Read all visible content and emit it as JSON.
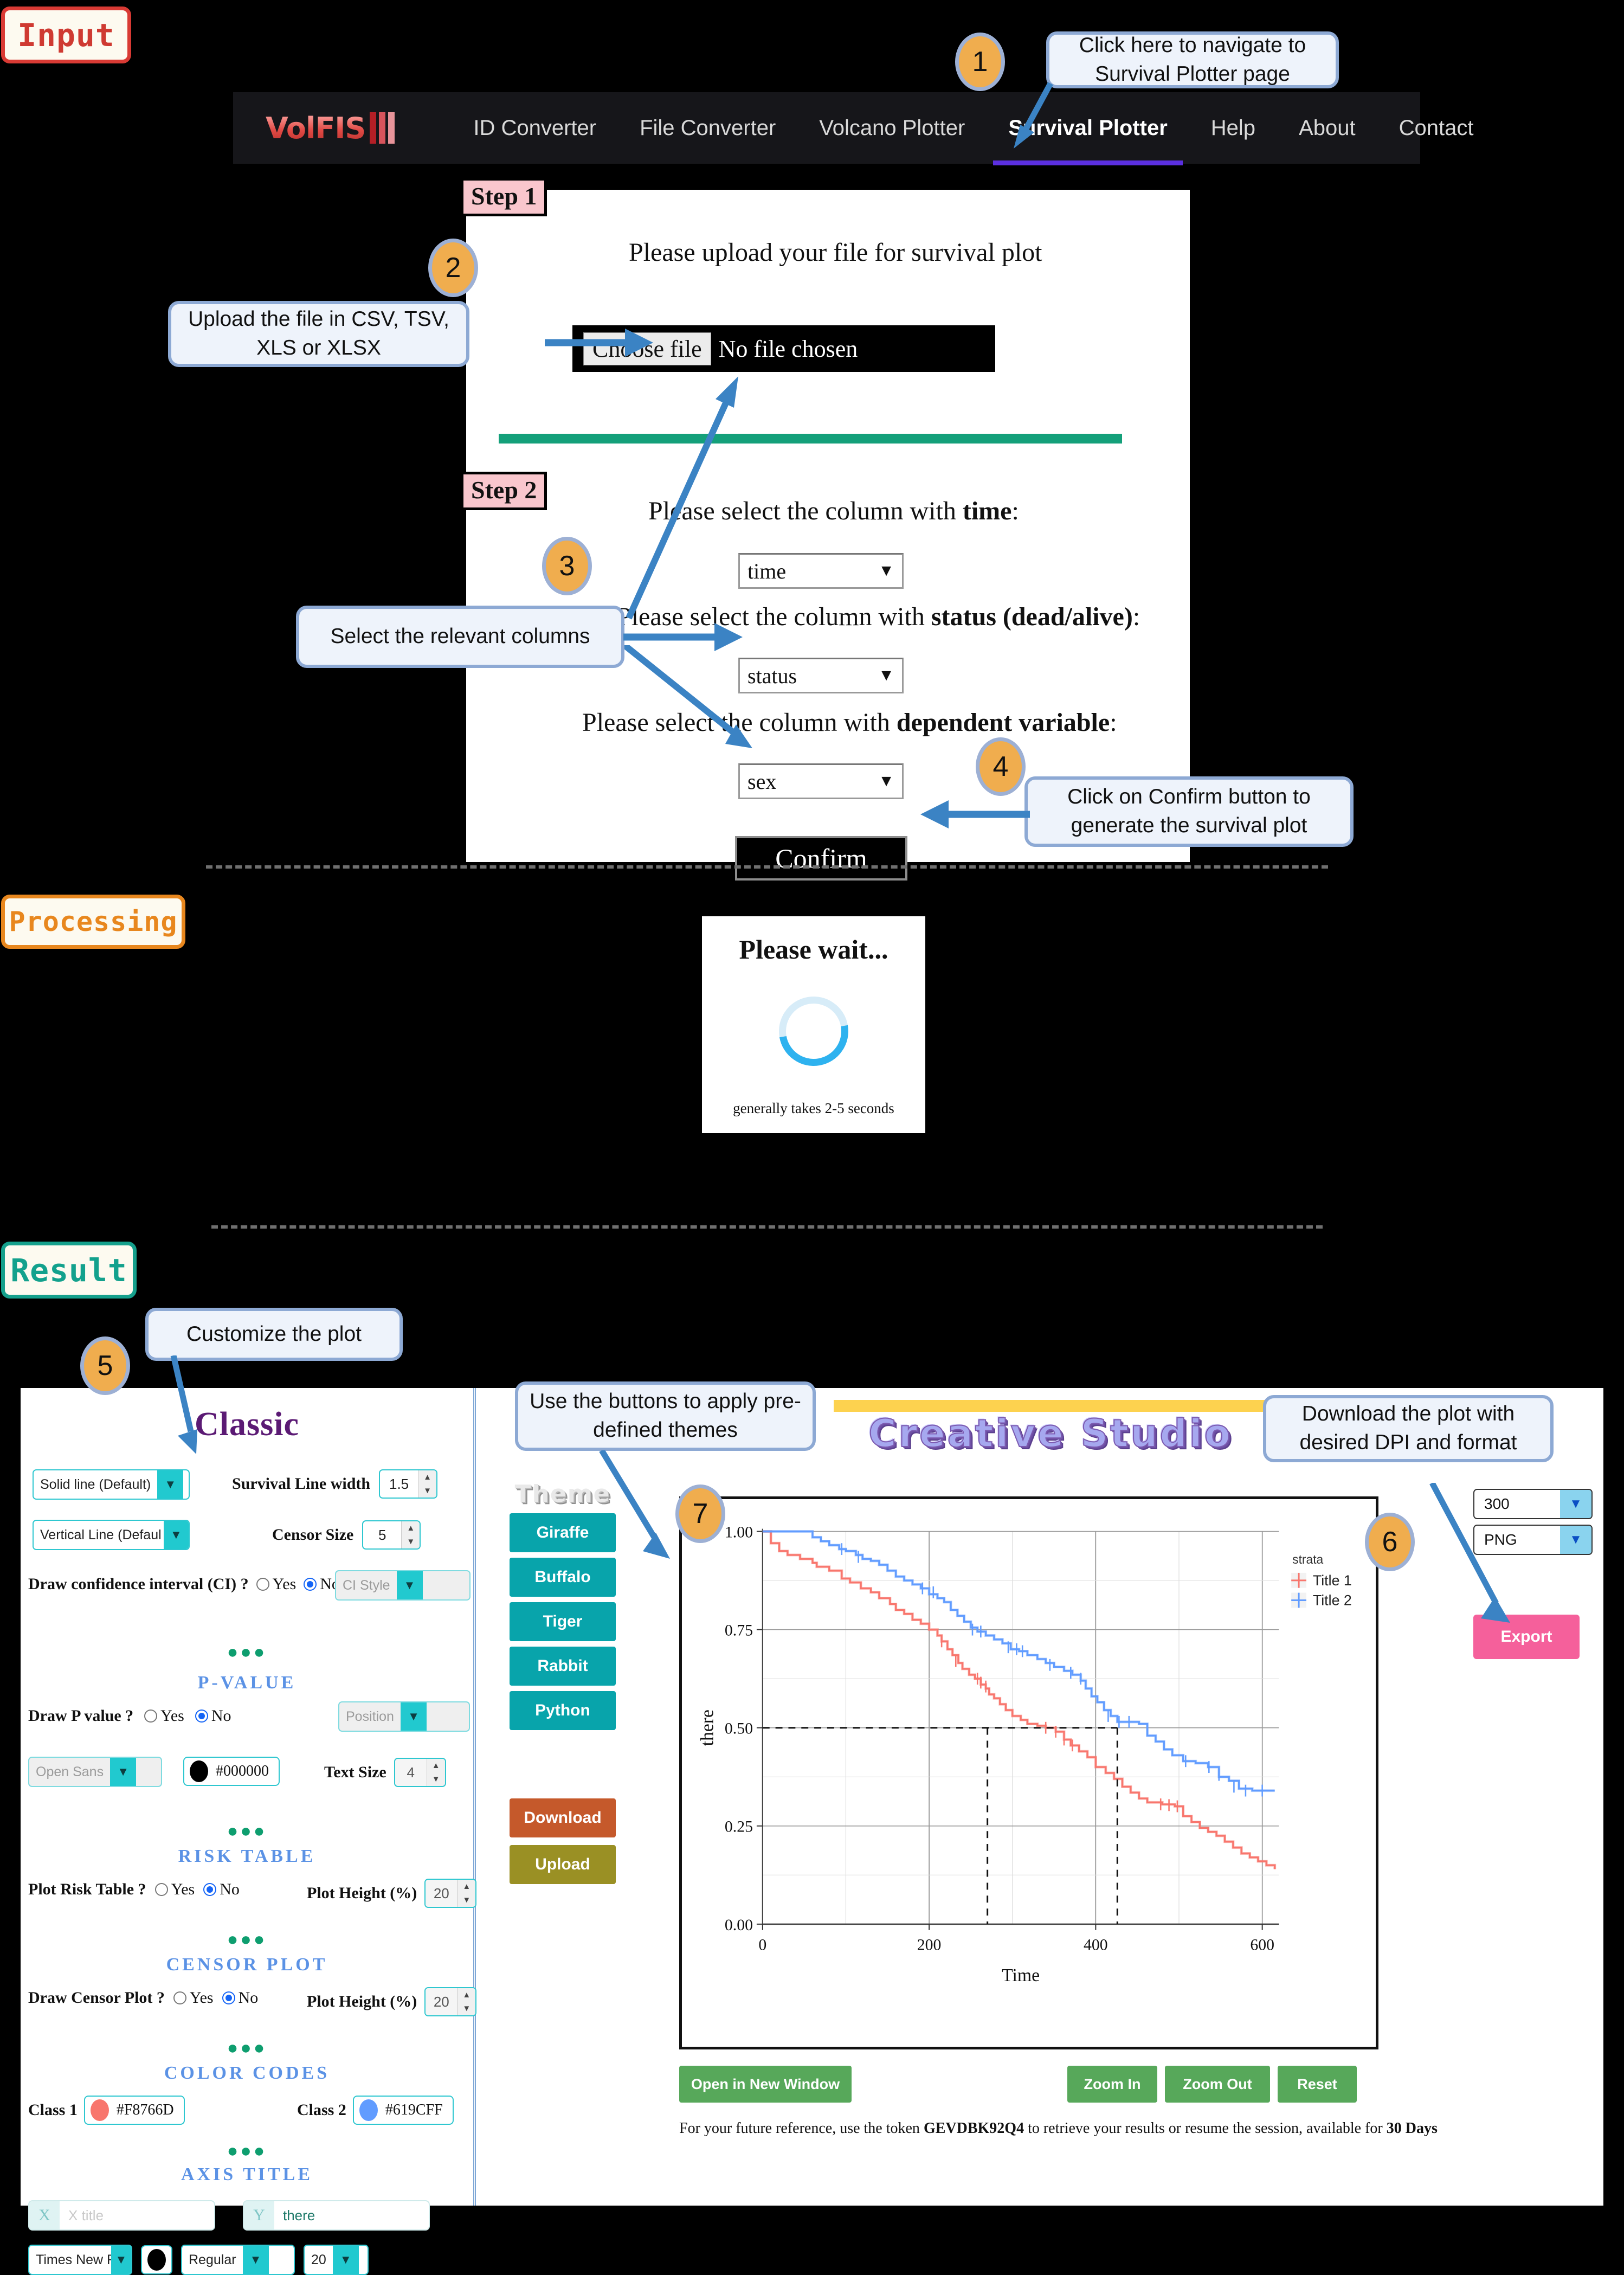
{
  "sections": {
    "input_tag": "Input",
    "processing_tag": "Processing",
    "result_tag": "Result"
  },
  "navbar": {
    "brand": "VolFIS",
    "links": [
      {
        "label": "ID Converter",
        "active": false
      },
      {
        "label": "File Converter",
        "active": false
      },
      {
        "label": "Volcano Plotter",
        "active": false
      },
      {
        "label": "Survival Plotter",
        "active": true
      },
      {
        "label": "Help",
        "active": false
      },
      {
        "label": "About",
        "active": false
      },
      {
        "label": "Contact",
        "active": false
      }
    ]
  },
  "callouts": {
    "c1": {
      "num": "1",
      "text": "Click here to navigate to Survival Plotter page"
    },
    "c2": {
      "num": "2",
      "text": "Upload the file in CSV, TSV, XLS or XLSX"
    },
    "c3": {
      "num": "3",
      "text": "Select the relevant columns"
    },
    "c4": {
      "num": "4",
      "text": "Click on Confirm button to generate the survival plot"
    },
    "c5": {
      "num": "5",
      "text": "Customize the plot"
    },
    "c6": {
      "num": "6",
      "text": "Download the plot with desired DPI and format"
    },
    "c7": {
      "num": "7",
      "text": "Use the buttons to apply pre-defined themes"
    }
  },
  "input_form": {
    "step1_tag": "Step 1",
    "step1_heading": "Please upload your file for survival plot",
    "choose_file_label": "Choose file",
    "no_file_text": "No file chosen",
    "step2_tag": "Step 2",
    "time_prompt_pre": "Please select the column with ",
    "time_prompt_bold": "time",
    "time_prompt_post": ":",
    "time_value": "time",
    "status_prompt_pre": "Please select the column with ",
    "status_prompt_bold": "status (dead/alive)",
    "status_prompt_post": ":",
    "status_value": "status",
    "dep_prompt_pre": "Please select the column with ",
    "dep_prompt_bold": "dependent variable",
    "dep_prompt_post": ":",
    "dep_value": "sex",
    "confirm_label": "Confirm"
  },
  "processing": {
    "title": "Please wait...",
    "note": "generally takes 2-5 seconds"
  },
  "classic": {
    "title": "Classic",
    "line_style": "Solid line (Default)",
    "vline_style": "Vertical Line (Defaul",
    "survival_line_width_label": "Survival Line width",
    "survival_line_width_value": "1.5",
    "censor_size_label": "Censor Size",
    "censor_size_value": "5",
    "ci_label": "Draw confidence interval (CI) ?",
    "ci_yes": "Yes",
    "ci_no": "No",
    "ci_selected": "No",
    "ci_style_placeholder": "CI Style",
    "pvalue_head": "P-VALUE",
    "pvalue_label": "Draw P value ?",
    "pvalue_yes": "Yes",
    "pvalue_no": "No",
    "pvalue_selected": "No",
    "position_placeholder": "Position",
    "font_placeholder": "Open Sans",
    "pvalue_color": "#000000",
    "text_size_label": "Text Size",
    "text_size_value": "4",
    "risk_head": "RISK TABLE",
    "risk_label": "Plot Risk Table ?",
    "risk_yes": "Yes",
    "risk_no": "No",
    "risk_selected": "No",
    "risk_height_label": "Plot Height (%)",
    "risk_height_value": "20",
    "censor_head": "CENSOR PLOT",
    "censor_label": "Draw Censor Plot ?",
    "censor_yes": "Yes",
    "censor_no": "No",
    "censor_selected": "No",
    "censor_height_label": "Plot Height (%)",
    "censor_height_value": "20",
    "color_head": "COLOR CODES",
    "class1_label": "Class 1",
    "class1_color": "#F8766D",
    "class2_label": "Class 2",
    "class2_color": "#619CFF",
    "axis_head": "AXIS TITLE",
    "x_prefix": "X",
    "x_placeholder": "X title",
    "y_prefix": "Y",
    "y_value": "there",
    "axis_font": "Times New Ro",
    "axis_font_color": "#000000",
    "axis_weight": "Regular",
    "axis_size": "20",
    "dots": "●●●"
  },
  "theme": {
    "title": "Theme",
    "buttons": [
      "Giraffe",
      "Buffalo",
      "Tiger",
      "Rabbit",
      "Python"
    ],
    "download_label": "Download",
    "upload_label": "Upload"
  },
  "creative_studio": {
    "title": "Creative Studio"
  },
  "export": {
    "dpi": "300",
    "format": "PNG",
    "export_label": "Export"
  },
  "plot_controls": {
    "open_new_window": "Open in New Window",
    "zoom_in": "Zoom In",
    "zoom_out": "Zoom Out",
    "reset": "Reset"
  },
  "token_note": {
    "pre": "For your future reference, use the token ",
    "token": "GEVDBK92Q4",
    "mid": " to retrieve your results or resume the session, available for ",
    "duration": "30 Days"
  },
  "chart_data": {
    "type": "line",
    "subtype": "kaplan-meier-step",
    "title": "",
    "xlabel": "Time",
    "ylabel": "there",
    "xlim": [
      0,
      620
    ],
    "ylim": [
      0,
      1
    ],
    "xticks": [
      0,
      200,
      400,
      600
    ],
    "yticks": [
      0.0,
      0.25,
      0.5,
      0.75,
      1.0
    ],
    "ytick_labels": [
      "0.00",
      "0.25",
      "0.50",
      "0.75",
      "1.00"
    ],
    "xtick_labels": [
      "0",
      "200",
      "400",
      "600"
    ],
    "grid": true,
    "legend_title": "strata",
    "legend_position": "right",
    "median_lines": {
      "style": "dashed",
      "y": 0.5,
      "x": [
        270,
        426
      ]
    },
    "series": [
      {
        "name": "Title 1",
        "color": "#F8766D",
        "points": [
          [
            0,
            1.0
          ],
          [
            10,
            0.97
          ],
          [
            20,
            0.95
          ],
          [
            30,
            0.94
          ],
          [
            45,
            0.93
          ],
          [
            60,
            0.92
          ],
          [
            65,
            0.91
          ],
          [
            80,
            0.9
          ],
          [
            95,
            0.88
          ],
          [
            105,
            0.87
          ],
          [
            118,
            0.855
          ],
          [
            130,
            0.845
          ],
          [
            140,
            0.83
          ],
          [
            153,
            0.815
          ],
          [
            160,
            0.8
          ],
          [
            170,
            0.79
          ],
          [
            180,
            0.775
          ],
          [
            190,
            0.765
          ],
          [
            200,
            0.75
          ],
          [
            210,
            0.735
          ],
          [
            215,
            0.72
          ],
          [
            222,
            0.7
          ],
          [
            228,
            0.685
          ],
          [
            235,
            0.665
          ],
          [
            240,
            0.65
          ],
          [
            248,
            0.635
          ],
          [
            255,
            0.625
          ],
          [
            262,
            0.61
          ],
          [
            268,
            0.6
          ],
          [
            272,
            0.585
          ],
          [
            278,
            0.575
          ],
          [
            285,
            0.56
          ],
          [
            292,
            0.545
          ],
          [
            300,
            0.53
          ],
          [
            310,
            0.52
          ],
          [
            318,
            0.51
          ],
          [
            330,
            0.505
          ],
          [
            340,
            0.5
          ],
          [
            352,
            0.49
          ],
          [
            362,
            0.47
          ],
          [
            370,
            0.455
          ],
          [
            380,
            0.44
          ],
          [
            390,
            0.425
          ],
          [
            400,
            0.4
          ],
          [
            412,
            0.385
          ],
          [
            422,
            0.37
          ],
          [
            432,
            0.35
          ],
          [
            442,
            0.335
          ],
          [
            452,
            0.32
          ],
          [
            462,
            0.31
          ],
          [
            480,
            0.305
          ],
          [
            495,
            0.3
          ],
          [
            505,
            0.275
          ],
          [
            515,
            0.26
          ],
          [
            525,
            0.245
          ],
          [
            535,
            0.235
          ],
          [
            545,
            0.225
          ],
          [
            555,
            0.21
          ],
          [
            565,
            0.195
          ],
          [
            575,
            0.18
          ],
          [
            585,
            0.17
          ],
          [
            595,
            0.16
          ],
          [
            605,
            0.15
          ],
          [
            615,
            0.14
          ]
        ]
      },
      {
        "name": "Title 2",
        "color": "#619CFF",
        "points": [
          [
            0,
            1.0
          ],
          [
            55,
            1.0
          ],
          [
            60,
            0.985
          ],
          [
            70,
            0.975
          ],
          [
            80,
            0.965
          ],
          [
            92,
            0.955
          ],
          [
            100,
            0.95
          ],
          [
            112,
            0.94
          ],
          [
            120,
            0.93
          ],
          [
            130,
            0.925
          ],
          [
            140,
            0.915
          ],
          [
            150,
            0.9
          ],
          [
            160,
            0.885
          ],
          [
            170,
            0.875
          ],
          [
            180,
            0.865
          ],
          [
            190,
            0.855
          ],
          [
            200,
            0.84
          ],
          [
            210,
            0.83
          ],
          [
            218,
            0.82
          ],
          [
            226,
            0.8
          ],
          [
            234,
            0.785
          ],
          [
            242,
            0.77
          ],
          [
            250,
            0.755
          ],
          [
            258,
            0.745
          ],
          [
            268,
            0.735
          ],
          [
            278,
            0.725
          ],
          [
            288,
            0.715
          ],
          [
            298,
            0.7
          ],
          [
            308,
            0.695
          ],
          [
            318,
            0.685
          ],
          [
            330,
            0.675
          ],
          [
            340,
            0.665
          ],
          [
            350,
            0.655
          ],
          [
            362,
            0.645
          ],
          [
            372,
            0.635
          ],
          [
            382,
            0.62
          ],
          [
            388,
            0.6
          ],
          [
            395,
            0.58
          ],
          [
            402,
            0.565
          ],
          [
            410,
            0.545
          ],
          [
            418,
            0.53
          ],
          [
            426,
            0.515
          ],
          [
            440,
            0.515
          ],
          [
            452,
            0.51
          ],
          [
            462,
            0.48
          ],
          [
            472,
            0.465
          ],
          [
            482,
            0.445
          ],
          [
            492,
            0.43
          ],
          [
            505,
            0.415
          ],
          [
            520,
            0.41
          ],
          [
            535,
            0.4
          ],
          [
            548,
            0.375
          ],
          [
            560,
            0.365
          ],
          [
            572,
            0.345
          ],
          [
            588,
            0.34
          ],
          [
            615,
            0.34
          ]
        ]
      }
    ],
    "censor_marks": [
      {
        "series": "Title 1",
        "points": [
          [
            215,
            0.72
          ],
          [
            232,
            0.67
          ],
          [
            258,
            0.625
          ],
          [
            262,
            0.615
          ],
          [
            268,
            0.605
          ],
          [
            340,
            0.5
          ],
          [
            352,
            0.49
          ],
          [
            362,
            0.47
          ],
          [
            372,
            0.455
          ],
          [
            478,
            0.305
          ],
          [
            488,
            0.303
          ],
          [
            498,
            0.3
          ]
        ]
      },
      {
        "series": "Title 2",
        "points": [
          [
            95,
            0.955
          ],
          [
            115,
            0.935
          ],
          [
            192,
            0.855
          ],
          [
            205,
            0.845
          ],
          [
            252,
            0.75
          ],
          [
            262,
            0.745
          ],
          [
            295,
            0.705
          ],
          [
            305,
            0.7
          ],
          [
            312,
            0.695
          ],
          [
            345,
            0.66
          ],
          [
            370,
            0.64
          ],
          [
            382,
            0.625
          ],
          [
            415,
            0.53
          ],
          [
            428,
            0.515
          ],
          [
            440,
            0.515
          ],
          [
            508,
            0.415
          ],
          [
            536,
            0.4
          ],
          [
            548,
            0.38
          ],
          [
            566,
            0.35
          ],
          [
            580,
            0.34
          ],
          [
            600,
            0.34
          ]
        ]
      }
    ]
  }
}
